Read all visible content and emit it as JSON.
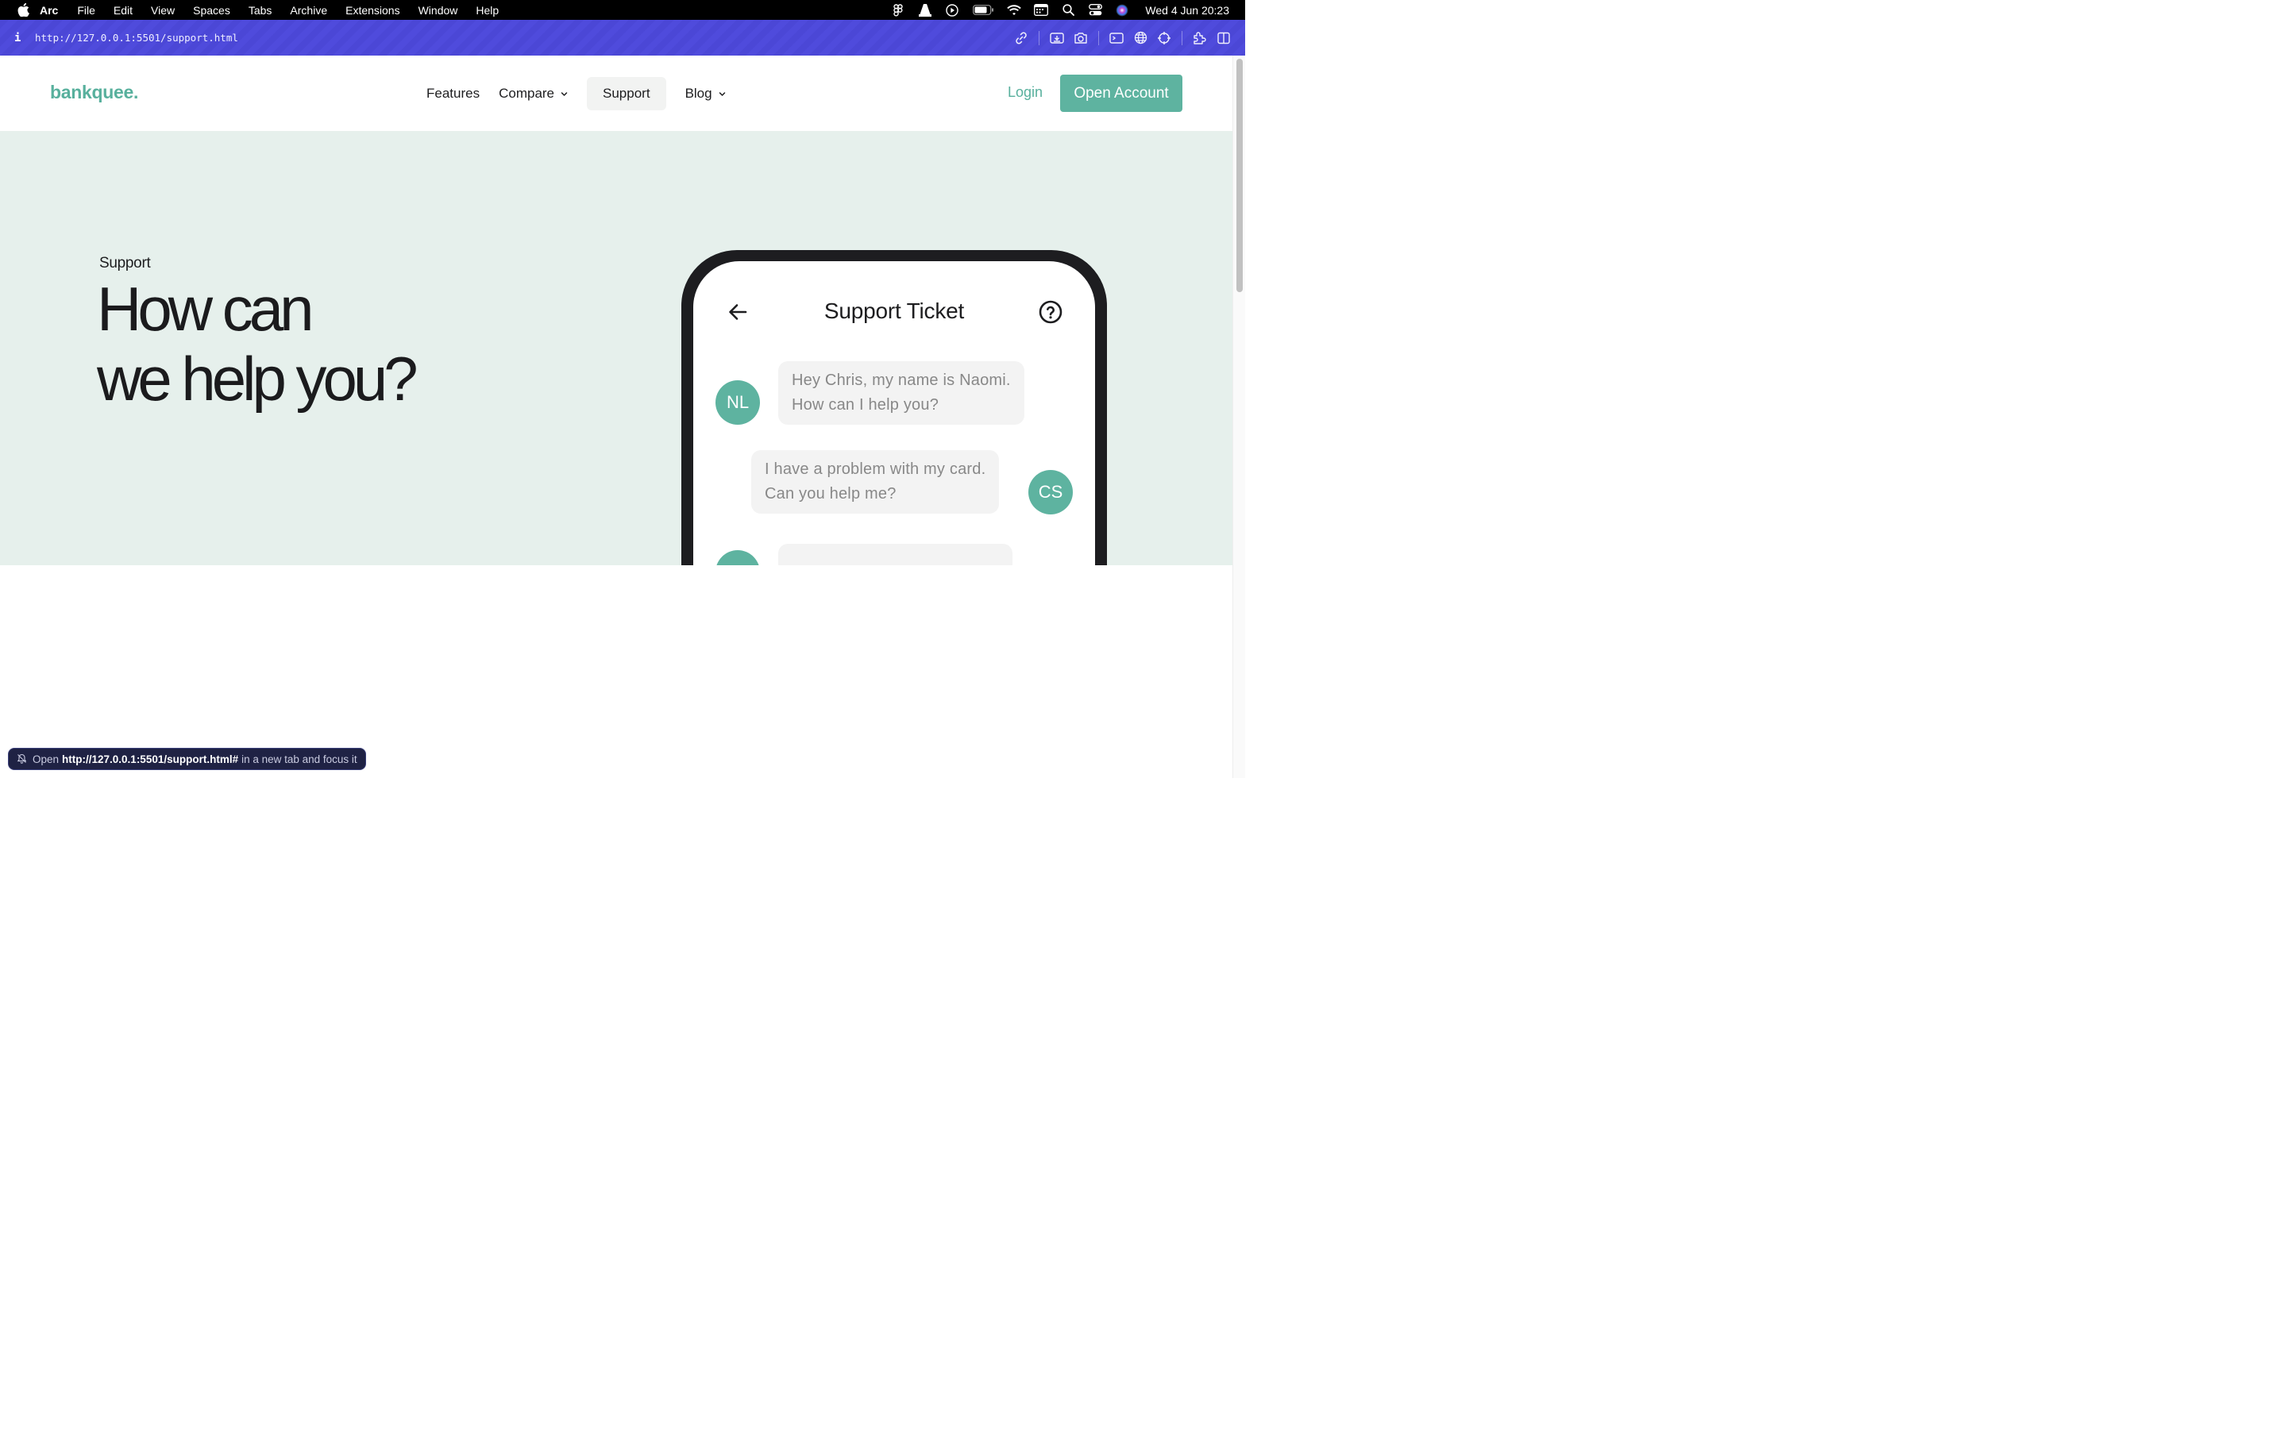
{
  "menubar": {
    "app_name": "Arc",
    "items": [
      "File",
      "Edit",
      "View",
      "Spaces",
      "Tabs",
      "Archive",
      "Extensions",
      "Window",
      "Help"
    ],
    "clock": "Wed 4 Jun  20:23"
  },
  "browser": {
    "info_glyph": "i",
    "url": "http://127.0.0.1:5501/support.html"
  },
  "nav": {
    "logo": "bankquee.",
    "links": [
      {
        "label": "Features"
      },
      {
        "label": "Compare"
      },
      {
        "label": "Support"
      },
      {
        "label": "Blog"
      }
    ],
    "login": "Login",
    "cta": "Open Account"
  },
  "hero": {
    "eyebrow": "Support",
    "headline_line1": "How can",
    "headline_line2": "we help you?"
  },
  "phone": {
    "title": "Support Ticket",
    "messages": [
      {
        "initials": "NL",
        "line1": "Hey Chris, my name is Naomi.",
        "line2": "How can I help you?"
      },
      {
        "initials": "CS",
        "line1": "I have a problem with my card.",
        "line2": "Can you help me?"
      }
    ]
  },
  "status_toast": {
    "prefix": "Open",
    "url": "http://127.0.0.1:5501/support.html#",
    "suffix": "in a new tab and focus it"
  },
  "colors": {
    "brand": "#58b09d",
    "button": "#5eb3a0",
    "hero_bg": "#e6f0ec",
    "addressbar": "#4b47d6"
  }
}
